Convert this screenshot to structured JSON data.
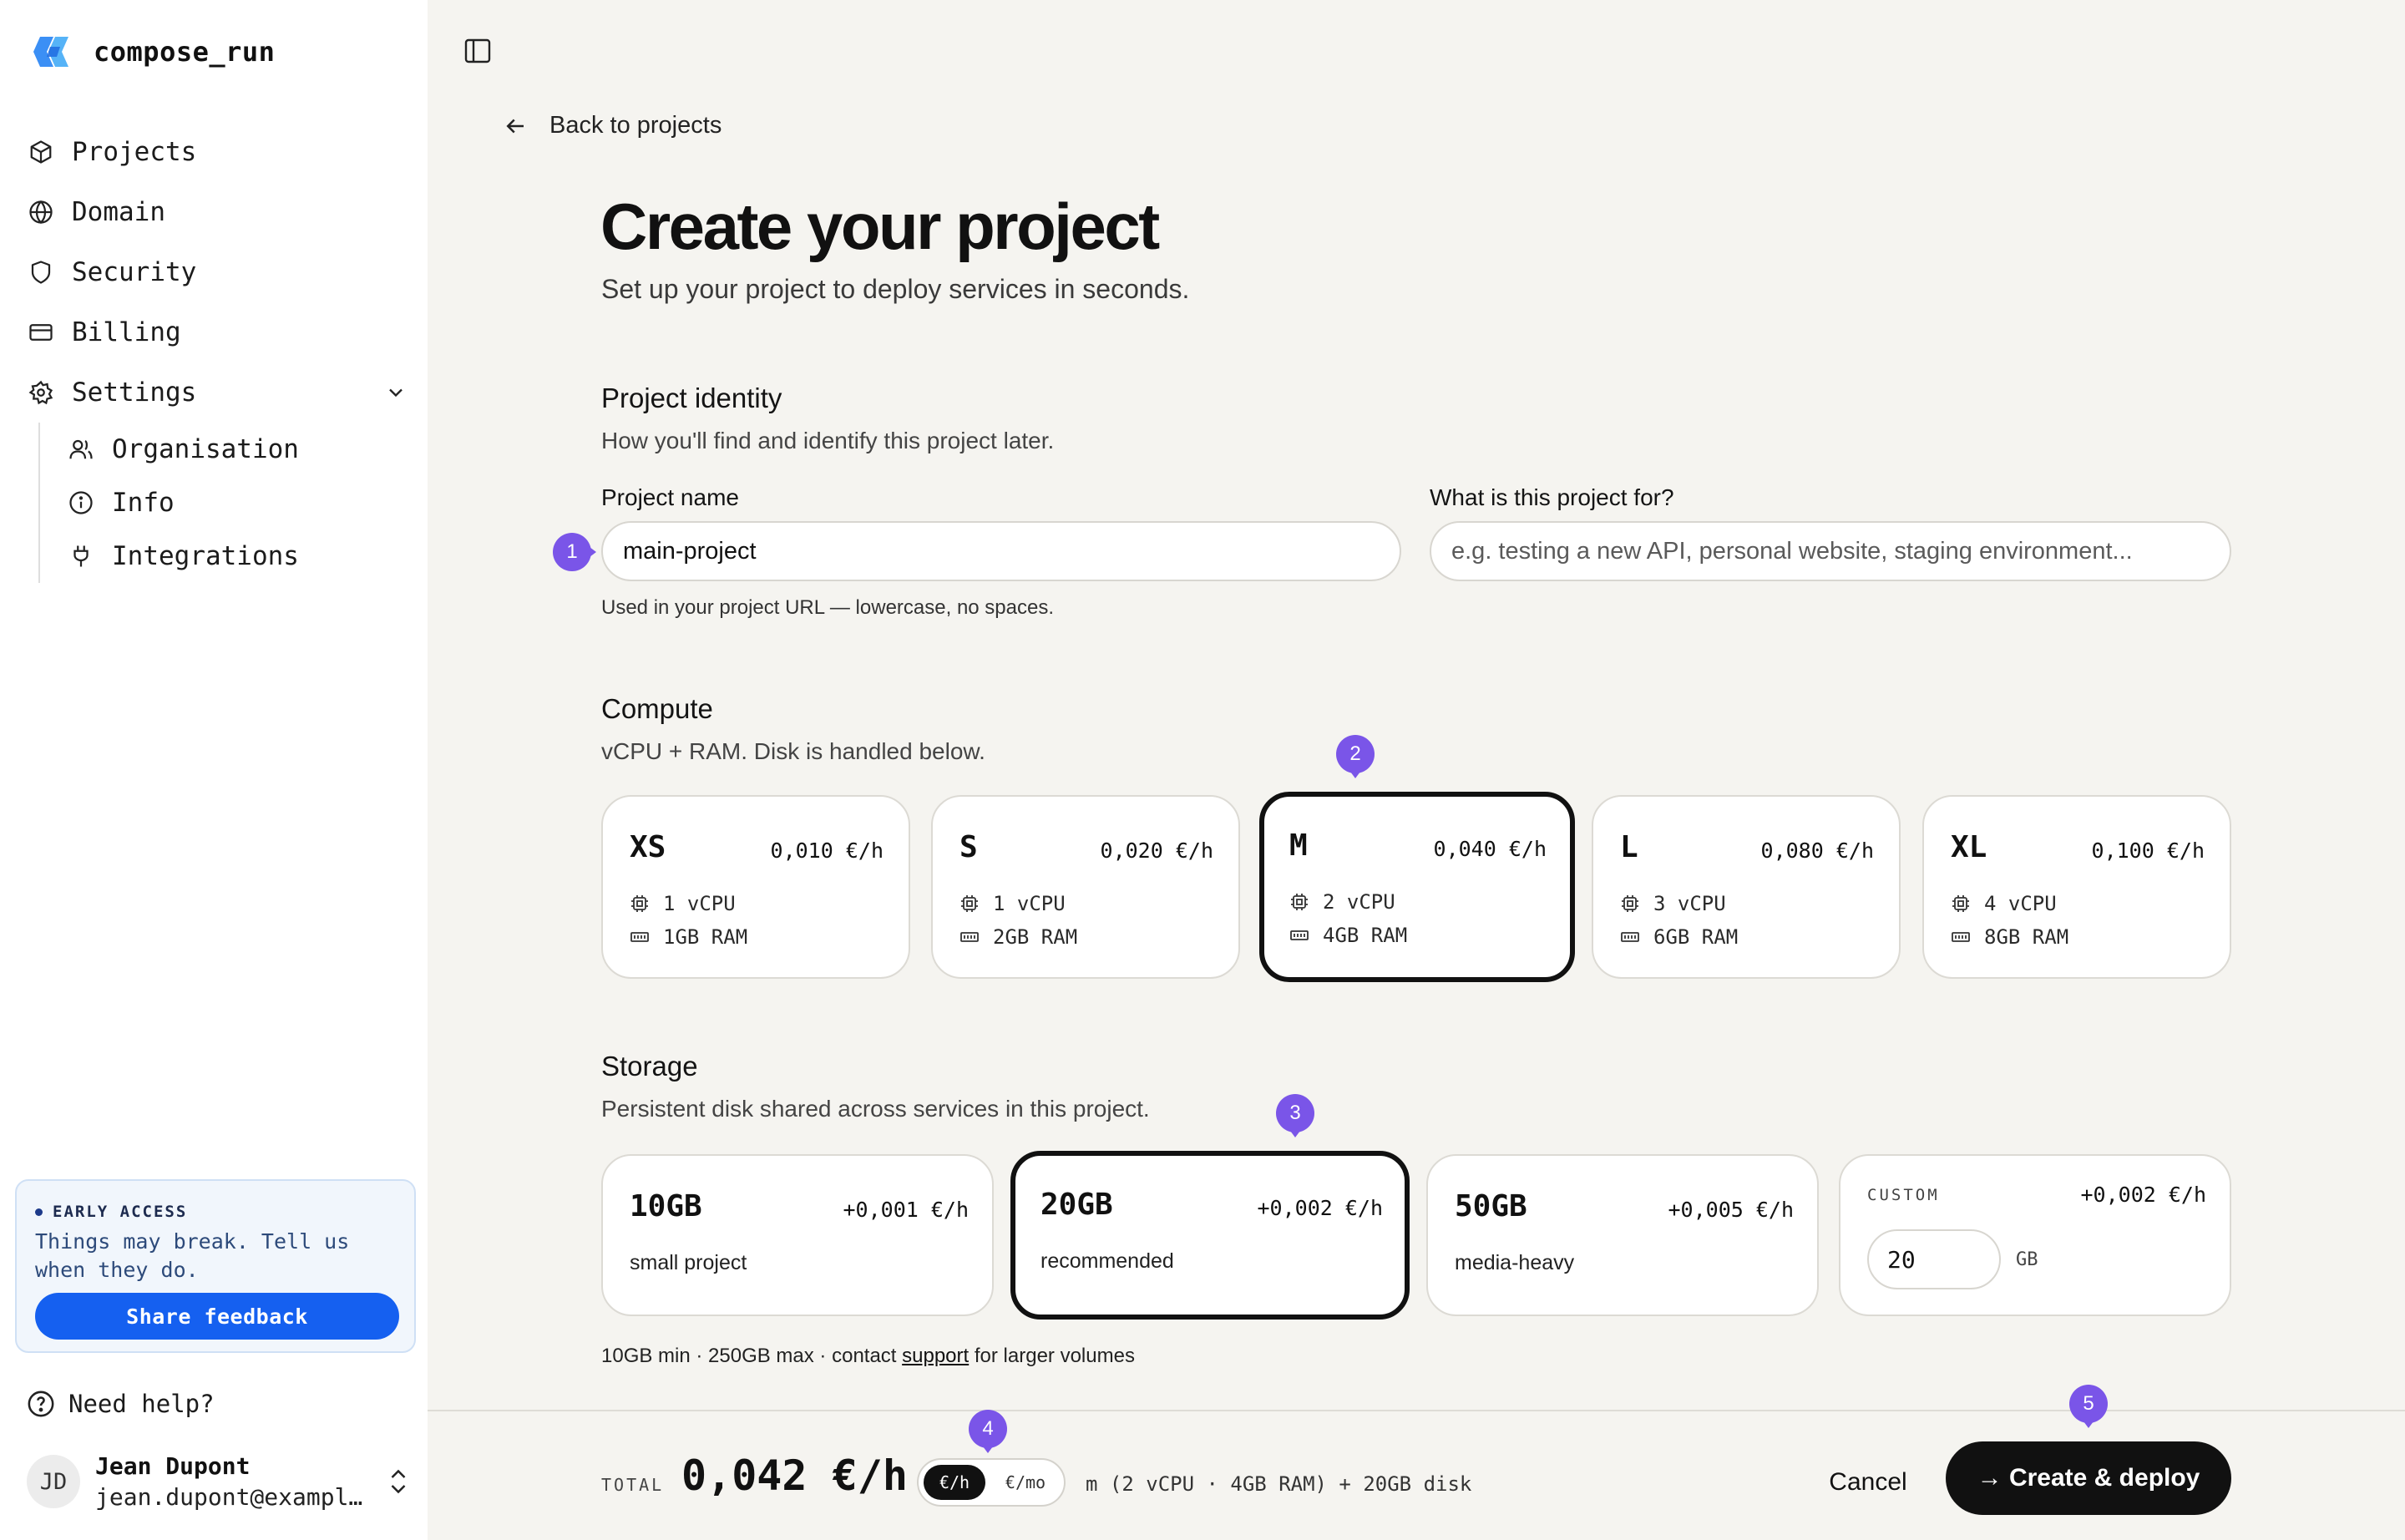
{
  "sidebar": {
    "brand": "compose_run",
    "items": [
      {
        "label": "Projects",
        "icon": "box-icon"
      },
      {
        "label": "Domain",
        "icon": "globe-icon"
      },
      {
        "label": "Security",
        "icon": "shield-icon"
      },
      {
        "label": "Billing",
        "icon": "credit-card-icon"
      },
      {
        "label": "Settings",
        "icon": "gear-icon"
      }
    ],
    "settings_items": [
      {
        "label": "Organisation",
        "icon": "users-icon"
      },
      {
        "label": "Info",
        "icon": "info-icon"
      },
      {
        "label": "Integrations",
        "icon": "plug-icon"
      }
    ],
    "early_access": {
      "tag": "EARLY ACCESS",
      "text": "Things may break. Tell us when they do.",
      "button": "Share feedback"
    },
    "help": "Need help?",
    "user": {
      "initials": "JD",
      "name": "Jean Dupont",
      "email": "jean.dupont@exampl…"
    }
  },
  "main": {
    "back": "Back to projects",
    "title": "Create your project",
    "subtitle": "Set up your project to deploy services in seconds.",
    "identity": {
      "title": "Project identity",
      "desc": "How you'll find and identify this project later.",
      "name_label": "Project name",
      "name_value": "main-project",
      "purpose_label": "What is this project for?",
      "purpose_placeholder": "e.g. testing a new API, personal website, staging environment...",
      "hint": "Used in your project URL — lowercase, no spaces."
    },
    "compute": {
      "title": "Compute",
      "desc": "vCPU + RAM. Disk is handled below.",
      "selected": "M",
      "options": [
        {
          "size": "XS",
          "price": "0,010 €/h",
          "cpu": "1 vCPU",
          "ram": "1GB RAM"
        },
        {
          "size": "S",
          "price": "0,020 €/h",
          "cpu": "1 vCPU",
          "ram": "2GB RAM"
        },
        {
          "size": "M",
          "price": "0,040 €/h",
          "cpu": "2 vCPU",
          "ram": "4GB RAM"
        },
        {
          "size": "L",
          "price": "0,080 €/h",
          "cpu": "3 vCPU",
          "ram": "6GB RAM"
        },
        {
          "size": "XL",
          "price": "0,100 €/h",
          "cpu": "4 vCPU",
          "ram": "8GB RAM"
        }
      ]
    },
    "storage": {
      "title": "Storage",
      "desc": "Persistent disk shared across services in this project.",
      "selected": "20GB",
      "options": [
        {
          "size": "10GB",
          "price": "+0,001 €/h",
          "desc": "small project"
        },
        {
          "size": "20GB",
          "price": "+0,002 €/h",
          "desc": "recommended"
        },
        {
          "size": "50GB",
          "price": "+0,005 €/h",
          "desc": "media-heavy"
        }
      ],
      "custom": {
        "tag": "CUSTOM",
        "price": "+0,002 €/h",
        "value": "20",
        "unit": "GB"
      },
      "note_prefix": "10GB min · 250GB max · contact ",
      "note_link": "support",
      "note_suffix": " for larger volumes"
    }
  },
  "footer": {
    "total_label": "TOTAL",
    "total_value": "0,042 €/h",
    "unit_on": "€/h",
    "unit_off": "€/mo",
    "summary": "m (2 vCPU · 4GB RAM) + 20GB disk",
    "cancel": "Cancel",
    "deploy": "→ Create & deploy"
  },
  "markers": [
    "1",
    "2",
    "3",
    "4",
    "5"
  ],
  "colors": {
    "accent": "#1560f0",
    "marker": "#7a55e8",
    "selected_border": "#111111",
    "background": "#f5f4f0"
  }
}
